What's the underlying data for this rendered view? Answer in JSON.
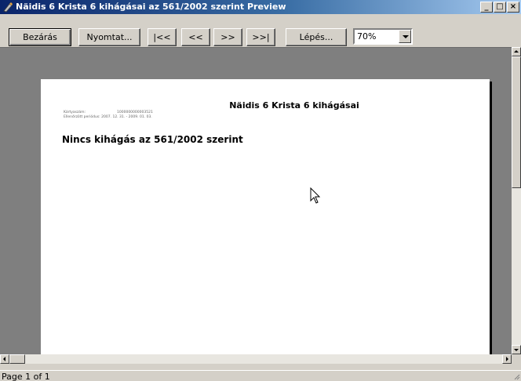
{
  "window": {
    "title": "Näidis 6 Krista 6 kihágásai az 561/2002 szerint Preview",
    "minimize_glyph": "_",
    "maximize_glyph": "□",
    "close_glyph": "×"
  },
  "toolbar": {
    "close_label": "Bezárás",
    "print_label": "Nyomtat...",
    "first_label": "|<<",
    "prev_label": "<<",
    "next_label": ">>",
    "last_label": ">>|",
    "goto_label": "Lépés...",
    "zoom_value": "70%"
  },
  "report": {
    "title": "Näidis 6 Krista 6 kihágásai",
    "card_label": "Kártyaszám:",
    "card_value": "1000000000003521",
    "period_label": "Ellenőrzött periódus:",
    "period_value": "2007. 12. 31. - 2009. 01. 03.",
    "headline": "Nincs kihágás az 561/2002 szerint"
  },
  "status": {
    "page_text": "Page 1 of 1"
  }
}
